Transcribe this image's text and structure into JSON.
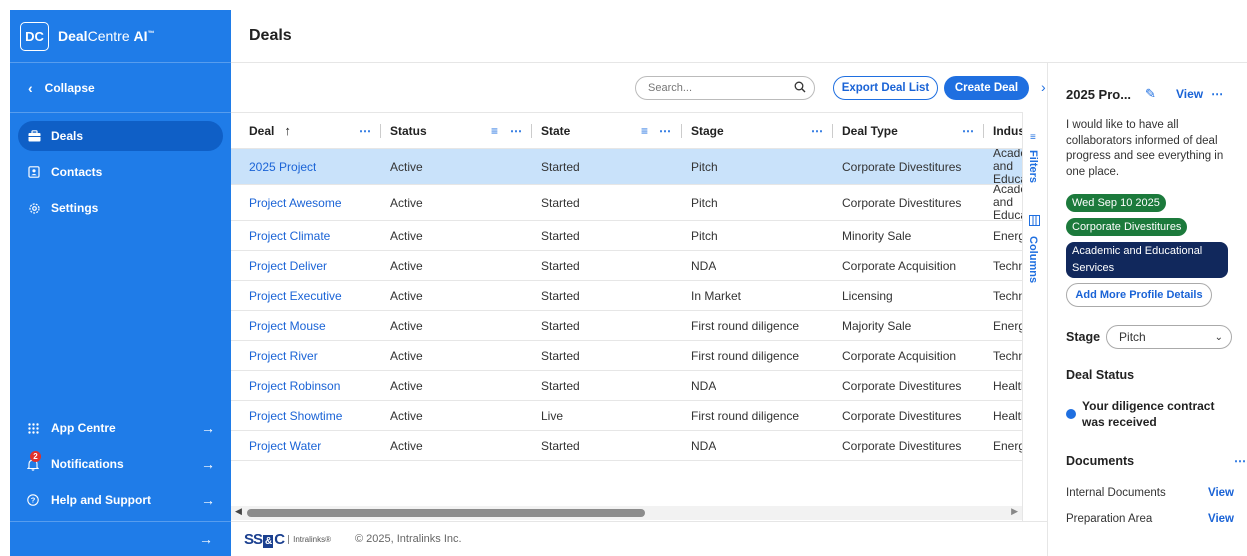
{
  "brand": {
    "logo": "DC",
    "name_bold": "Deal",
    "name_rest": "Centre ",
    "name_ai": "AI",
    "tm": "™"
  },
  "sidebar": {
    "collapse_label": "Collapse",
    "items": [
      {
        "label": "Deals",
        "icon": "briefcase-icon"
      },
      {
        "label": "Contacts",
        "icon": "contacts-icon"
      },
      {
        "label": "Settings",
        "icon": "gear-icon"
      }
    ],
    "bottom": [
      {
        "label": "App Centre",
        "icon": "grid-icon"
      },
      {
        "label": "Notifications",
        "icon": "bell-icon",
        "badge": "2"
      },
      {
        "label": "Help and Support",
        "icon": "help-icon"
      }
    ]
  },
  "header": {
    "title": "Deals"
  },
  "toolbar": {
    "search_placeholder": "Search...",
    "export_label": "Export Deal List",
    "create_label": "Create Deal"
  },
  "grid": {
    "columns": [
      "Deal",
      "Status",
      "State",
      "Stage",
      "Deal Type",
      "Indus"
    ],
    "rows": [
      {
        "deal": "2025 Project",
        "status": "Active",
        "state": "Started",
        "stage": "Pitch",
        "type": "Corporate Divestitures",
        "industry": "Academic and Educational"
      },
      {
        "deal": "Project Awesome",
        "status": "Active",
        "state": "Started",
        "stage": "Pitch",
        "type": "Corporate Divestitures",
        "industry": "Academic and Educational"
      },
      {
        "deal": "Project Climate",
        "status": "Active",
        "state": "Started",
        "stage": "Pitch",
        "type": "Minority Sale",
        "industry": "Energy"
      },
      {
        "deal": "Project Deliver",
        "status": "Active",
        "state": "Started",
        "stage": "NDA",
        "type": "Corporate Acquisition",
        "industry": "Technology"
      },
      {
        "deal": "Project Executive",
        "status": "Active",
        "state": "Started",
        "stage": "In Market",
        "type": "Licensing",
        "industry": "Technology"
      },
      {
        "deal": "Project Mouse",
        "status": "Active",
        "state": "Started",
        "stage": "First round diligence",
        "type": "Majority Sale",
        "industry": "Energy"
      },
      {
        "deal": "Project River",
        "status": "Active",
        "state": "Started",
        "stage": "First round diligence",
        "type": "Corporate Acquisition",
        "industry": "Technology"
      },
      {
        "deal": "Project Robinson",
        "status": "Active",
        "state": "Started",
        "stage": "NDA",
        "type": "Corporate Divestitures",
        "industry": "Healthcare"
      },
      {
        "deal": "Project Showtime",
        "status": "Active",
        "state": "Live",
        "stage": "First round diligence",
        "type": "Corporate Divestitures",
        "industry": "Healthcare"
      },
      {
        "deal": "Project Water",
        "status": "Active",
        "state": "Started",
        "stage": "NDA",
        "type": "Corporate Divestitures",
        "industry": "Energy"
      }
    ]
  },
  "strip": {
    "filters": "Filters",
    "columns": "Columns"
  },
  "footer": {
    "logo_ss": "SS",
    "logo_amp": "&",
    "logo_c": "C",
    "logo_sub": "Intralinks®",
    "copyright": "© 2025, Intralinks Inc."
  },
  "panel": {
    "title": "2025 Pro...",
    "view": "View",
    "description": "I would like to have all collaborators informed of deal progress and see everything in one place.",
    "tags": [
      "Wed Sep 10 2025",
      "Corporate Divestitures",
      "Academic and Educational Services"
    ],
    "add_more": "Add More Profile Details",
    "stage_label": "Stage",
    "stage_value": "Pitch",
    "deal_status_title": "Deal Status",
    "deal_status_item": "Your diligence contract was received",
    "documents_title": "Documents",
    "documents": [
      {
        "name": "Internal Documents",
        "action": "View"
      },
      {
        "name": "Preparation Area",
        "action": "View"
      }
    ]
  },
  "colors": {
    "sidebar": "#1f7ce8",
    "accent": "#1f6fe0",
    "selected_row": "#c9e2fa",
    "tag_green": "#1c7a3c",
    "tag_navy": "#11285c"
  }
}
